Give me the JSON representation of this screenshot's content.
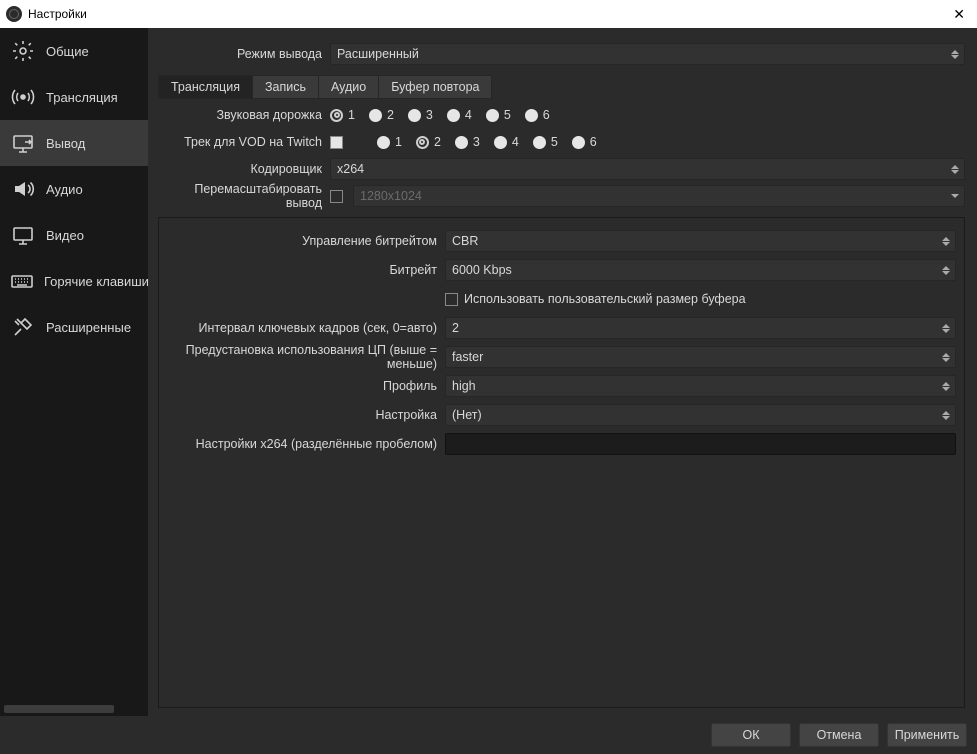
{
  "title": "Настройки",
  "sidebar": {
    "items": [
      {
        "label": "Общие"
      },
      {
        "label": "Трансляция"
      },
      {
        "label": "Вывод"
      },
      {
        "label": "Аудио"
      },
      {
        "label": "Видео"
      },
      {
        "label": "Горячие клавиши"
      },
      {
        "label": "Расширенные"
      }
    ]
  },
  "outputMode": {
    "label": "Режим вывода",
    "value": "Расширенный"
  },
  "tabs": [
    "Трансляция",
    "Запись",
    "Аудио",
    "Буфер повтора"
  ],
  "audioTrack": {
    "label": "Звуковая дорожка",
    "options": [
      "1",
      "2",
      "3",
      "4",
      "5",
      "6"
    ],
    "selected": 0
  },
  "vodTrack": {
    "label": "Трек для VOD на Twitch",
    "options": [
      "1",
      "2",
      "3",
      "4",
      "5",
      "6"
    ],
    "selected": 1
  },
  "encoder": {
    "label": "Кодировщик",
    "value": "x264"
  },
  "rescale": {
    "label": "Перемасштабировать вывод",
    "checked": false,
    "value": "1280x1024"
  },
  "rateControl": {
    "label": "Управление битрейтом",
    "value": "CBR"
  },
  "bitrate": {
    "label": "Битрейт",
    "value": "6000 Kbps"
  },
  "customBuf": {
    "checked": false,
    "label": "Использовать пользовательский размер буфера"
  },
  "keyint": {
    "label": "Интервал ключевых кадров (сек, 0=авто)",
    "value": "2"
  },
  "preset": {
    "label": "Предустановка использования ЦП (выше = меньше)",
    "value": "faster"
  },
  "profile": {
    "label": "Профиль",
    "value": "high"
  },
  "tune": {
    "label": "Настройка",
    "value": "(Нет)"
  },
  "x264opts": {
    "label": "Настройки x264 (разделённые пробелом)",
    "value": ""
  },
  "buttons": {
    "ok": "ОК",
    "cancel": "Отмена",
    "apply": "Применить"
  }
}
